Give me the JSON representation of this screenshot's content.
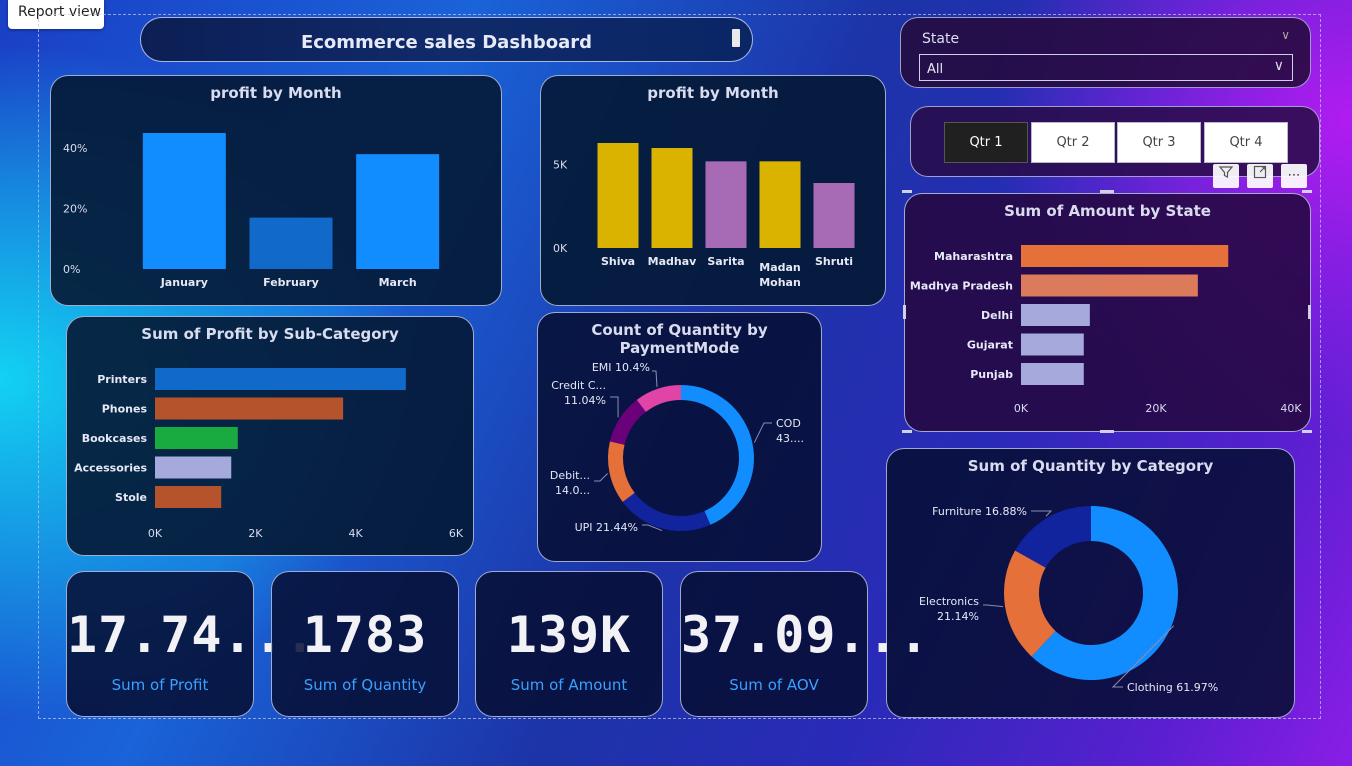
{
  "report_view_label": "Report view",
  "title": "Ecommerce sales Dashboard",
  "slicer_state": {
    "label": "State",
    "value": "All"
  },
  "quarters": [
    {
      "label": "Qtr 1",
      "selected": true
    },
    {
      "label": "Qtr 2",
      "selected": false
    },
    {
      "label": "Qtr 3",
      "selected": false
    },
    {
      "label": "Qtr 4",
      "selected": false
    }
  ],
  "visual_header_icons": [
    "filter-icon",
    "focus-mode-icon",
    "more-options-icon"
  ],
  "kpis": [
    {
      "value": "17.74...",
      "label": "Sum of Profit"
    },
    {
      "value": "1783",
      "label": "Sum of Quantity"
    },
    {
      "value": "139K",
      "label": "Sum of Amount"
    },
    {
      "value": "37.09...",
      "label": "Sum of AOV"
    }
  ],
  "colors": {
    "blue": "#118dff",
    "dark_blue": "#1169c9",
    "gold": "#d9b300",
    "mauve": "#a66bb4",
    "orange": "#e6703a",
    "rust": "#b5532c",
    "green": "#1aab40",
    "lavender": "#a6a9dc",
    "navy": "#12239e",
    "purple": "#6b007b",
    "pink": "#e044a7"
  },
  "chart_data": [
    {
      "id": "profit_by_month",
      "type": "bar",
      "title": "profit by Month",
      "categories": [
        "January",
        "February",
        "March"
      ],
      "values": [
        45,
        17,
        38
      ],
      "ylim": [
        0,
        45
      ],
      "yticks": [
        "0%",
        "20%",
        "40%"
      ],
      "ytick_values": [
        0,
        20,
        40
      ],
      "colors": [
        "#118dff",
        "#1169c9",
        "#118dff"
      ]
    },
    {
      "id": "profit_by_person",
      "type": "bar",
      "title": "profit by Month",
      "categories": [
        "Shiva",
        "Madhav",
        "Sarita",
        "Madan Mohan",
        "Shruti"
      ],
      "values": [
        6300,
        6000,
        5200,
        5200,
        3900
      ],
      "ylim": [
        0,
        6300
      ],
      "yticks": [
        "0K",
        "5K"
      ],
      "ytick_values": [
        0,
        5000
      ],
      "colors": [
        "#d9b300",
        "#d9b300",
        "#a66bb4",
        "#d9b300",
        "#a66bb4"
      ]
    },
    {
      "id": "amount_by_state",
      "type": "bar",
      "orientation": "horizontal",
      "title": "Sum of Amount by State",
      "categories": [
        "Maharashtra",
        "Madhya Pradesh",
        "Delhi",
        "Gujarat",
        "Punjab"
      ],
      "values": [
        30700,
        26200,
        10200,
        9300,
        9300
      ],
      "xlim": [
        0,
        40000
      ],
      "xticks": [
        "0K",
        "20K",
        "40K"
      ],
      "xtick_values": [
        0,
        20000,
        40000
      ],
      "colors": [
        "#e6703a",
        "#dc7a5c",
        "#a6a9dc",
        "#a6a9dc",
        "#a6a9dc"
      ]
    },
    {
      "id": "profit_by_subcategory",
      "type": "bar",
      "orientation": "horizontal",
      "title": "Sum of Profit by Sub-Category",
      "categories": [
        "Printers",
        "Phones",
        "Bookcases",
        "Accessories",
        "Stole"
      ],
      "values": [
        5000,
        3750,
        1650,
        1520,
        1320
      ],
      "xlim": [
        0,
        6000
      ],
      "xticks": [
        "0K",
        "2K",
        "4K",
        "6K"
      ],
      "xtick_values": [
        0,
        2000,
        4000,
        6000
      ],
      "colors": [
        "#1169c9",
        "#b5532c",
        "#1aab40",
        "#a6a9dc",
        "#b5532c"
      ]
    },
    {
      "id": "quantity_by_paymentmode",
      "type": "pie",
      "title": "Count of Quantity by PaymentMode",
      "labels": [
        "COD",
        "UPI",
        "Debit...",
        "Credit C...",
        "EMI"
      ],
      "values": [
        43.6,
        21.44,
        14.0,
        11.04,
        10.4
      ],
      "slice_labels": [
        "COD\n43....",
        "UPI 21.44%",
        "Debit...\n14.0...",
        "Credit C...\n11.04%",
        "EMI 10.4%"
      ],
      "colors": [
        "#118dff",
        "#12239e",
        "#e6703a",
        "#6b007b",
        "#e044a7"
      ]
    },
    {
      "id": "quantity_by_category",
      "type": "pie",
      "title": "Sum of Quantity by Category",
      "labels": [
        "Clothing",
        "Electronics",
        "Furniture"
      ],
      "values": [
        61.97,
        21.14,
        16.88
      ],
      "slice_labels": [
        "Clothing 61.97%",
        "Electronics\n21.14%",
        "Furniture 16.88%"
      ],
      "colors": [
        "#118dff",
        "#e6703a",
        "#12239e"
      ]
    }
  ]
}
